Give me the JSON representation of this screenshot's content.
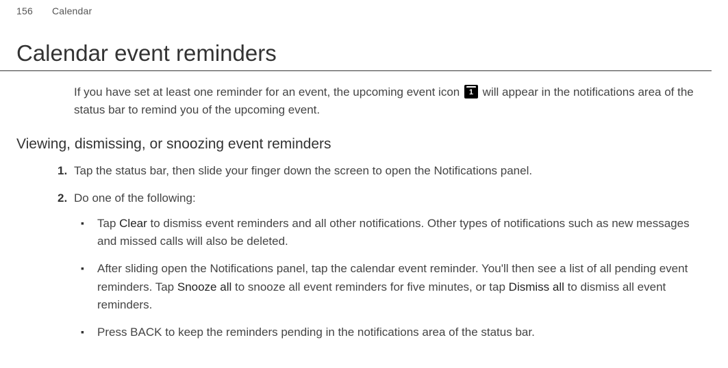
{
  "header": {
    "pageNumber": "156",
    "sectionName": "Calendar"
  },
  "title": "Calendar event reminders",
  "intro": {
    "part1": "If you have set at least one reminder for an event, the upcoming event icon ",
    "iconNum": "1",
    "part2": " will appear in the notifications area of the status bar to remind you of the upcoming event."
  },
  "subheading": "Viewing, dismissing, or snoozing event reminders",
  "steps": {
    "s1": "Tap the status bar, then slide your finger down the screen to open the Notifications panel.",
    "s2": "Do one of the following:",
    "bullets": {
      "b1": {
        "t1": "Tap ",
        "bold1": "Clear",
        "t2": " to dismiss event reminders and all other notifications. Other types of notifications such as new messages and missed calls will also be deleted."
      },
      "b2": {
        "t1": "After sliding open the Notifications panel, tap the calendar event reminder. You'll then see a list of all pending event reminders. Tap ",
        "bold1": "Snooze all",
        "t2": " to snooze all event reminders for five minutes, or tap ",
        "bold2": "Dismiss all",
        "t3": " to dismiss all event reminders."
      },
      "b3": "Press BACK to keep the reminders pending in the notifications area of the status bar."
    }
  }
}
